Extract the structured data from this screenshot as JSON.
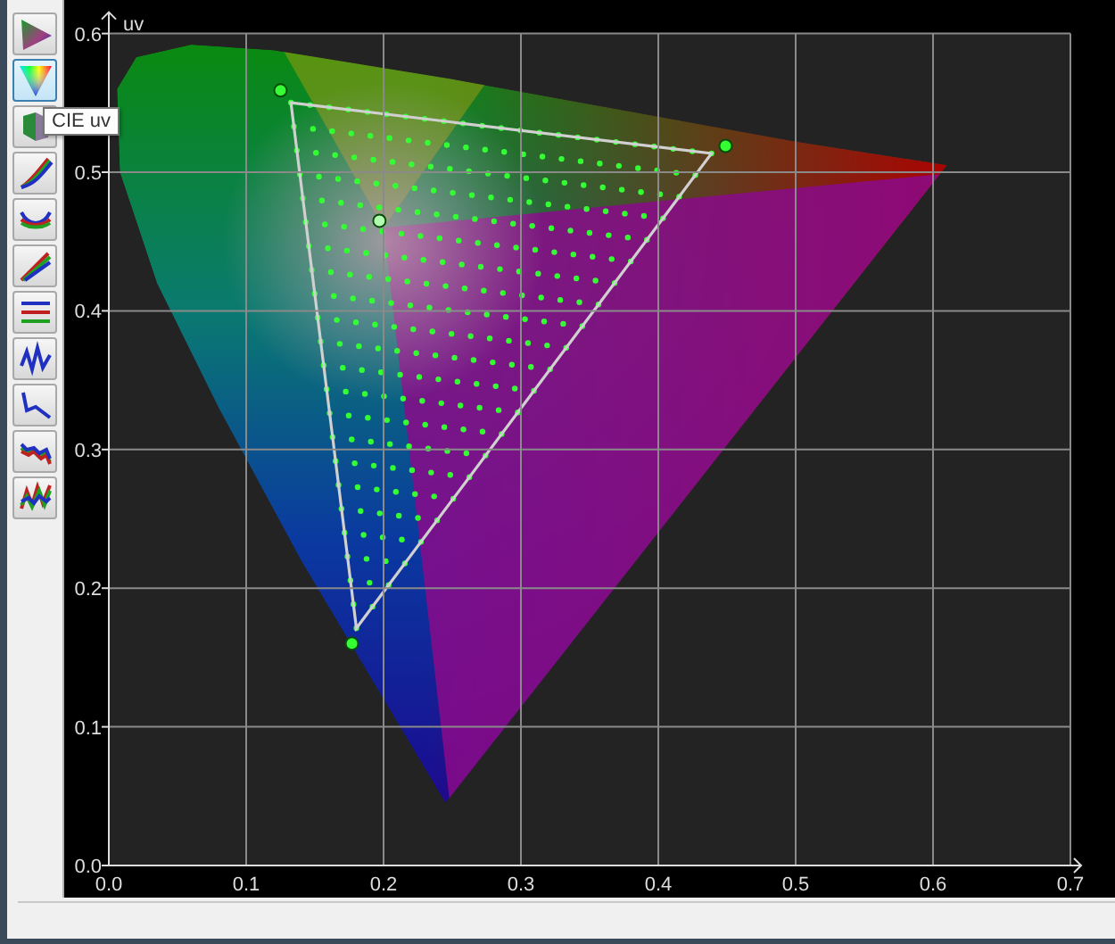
{
  "toolbar": [
    {
      "kind": "gamut",
      "selected": false
    },
    {
      "kind": "color-gamut",
      "selected": true
    },
    {
      "kind": "solid",
      "selected": false
    },
    {
      "kind": "gamma",
      "selected": false
    },
    {
      "kind": "wave",
      "selected": false
    },
    {
      "kind": "ramp",
      "selected": false
    },
    {
      "kind": "flat",
      "selected": false
    },
    {
      "kind": "line",
      "selected": false
    },
    {
      "kind": "drop",
      "selected": false
    },
    {
      "kind": "noisy",
      "selected": false
    },
    {
      "kind": "jagged",
      "selected": false
    }
  ],
  "tooltip": "CIE uv",
  "plot": {
    "chart_data": {
      "type": "scatter",
      "ylabel": "uv",
      "x": [
        0.125,
        0.449,
        0.177,
        0.197
      ],
      "grid": true,
      "series": [
        {
          "color": "#33ff33",
          "values": [
            0.559,
            0.519,
            0.16,
            null
          ]
        },
        {
          "color": "#b0ffb0",
          "values": [
            null,
            null,
            null,
            0.465
          ]
        }
      ],
      "xlim": [
        0,
        0.7
      ],
      "ylim": [
        0,
        0.6
      ],
      "xticks": [
        {
          "value": 0,
          "label": "0.0"
        },
        {
          "value": 0.1,
          "label": "0.1"
        },
        {
          "value": 0.2,
          "label": "0.2"
        },
        {
          "value": 0.3,
          "label": "0.3"
        },
        {
          "value": 0.4,
          "label": "0.4"
        },
        {
          "value": 0.5,
          "label": "0.5"
        },
        {
          "value": 0.6,
          "label": "0.6"
        },
        {
          "value": 0.7,
          "label": "0.7"
        }
      ],
      "yticks": [
        {
          "value": 0,
          "label": "0.0"
        },
        {
          "value": 0.1,
          "label": "0.1"
        },
        {
          "value": 0.2,
          "label": "0.2"
        },
        {
          "value": 0.3,
          "label": "0.3"
        },
        {
          "value": 0.4,
          "label": "0.4"
        },
        {
          "value": 0.5,
          "label": "0.5"
        },
        {
          "value": 0.6,
          "label": "0.6"
        }
      ]
    }
  }
}
